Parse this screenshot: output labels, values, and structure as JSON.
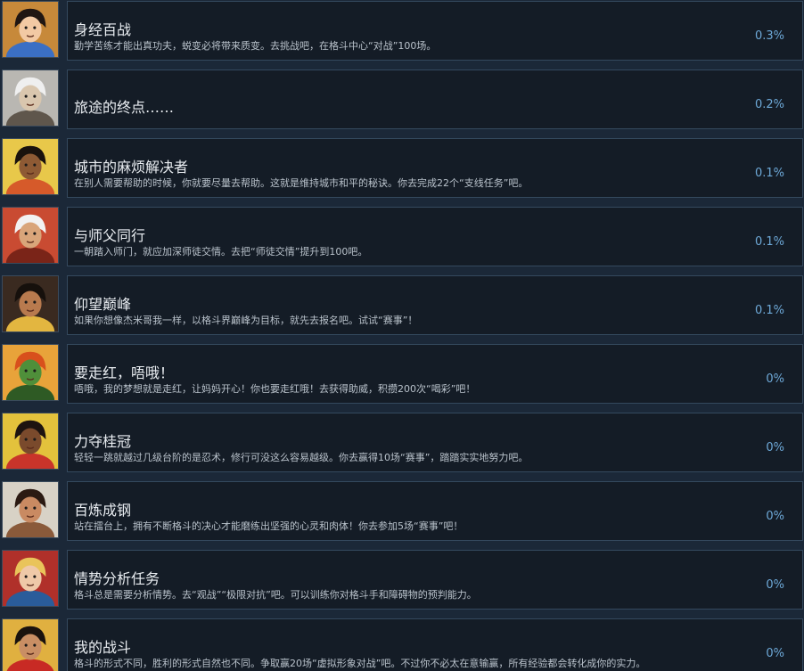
{
  "achievements": [
    {
      "title": "身经百战",
      "desc": "勤学苦练才能出真功夫，蜕变必将带来质变。去挑战吧，在格斗中心“对战”100场。",
      "percent": "0.3%",
      "icon": "portrait-chunli-icon",
      "bg": "#c7893a",
      "skin": "#f2c9a4",
      "hair": "#201612",
      "accent": "#3b6fc4"
    },
    {
      "title": "旅途的终点……",
      "desc": "",
      "percent": "0.2%",
      "icon": "portrait-oro-icon",
      "bg": "#b9b7b2",
      "skin": "#d9c6ae",
      "hair": "#efefef",
      "accent": "#5f564c"
    },
    {
      "title": "城市的麻烦解决者",
      "desc": "在别人需要帮助的时候，你就要尽量去帮助。这就是维持城市和平的秘诀。你去完成22个“支线任务”吧。",
      "percent": "0.1%",
      "icon": "portrait-dhalsim-icon",
      "bg": "#e8c84a",
      "skin": "#8e5a34",
      "hair": "#1a120d",
      "accent": "#d65a2a"
    },
    {
      "title": "与师父同行",
      "desc": "一朝踏入师门，就应加深师徒交情。去把“师徒交情”提升到100吧。",
      "percent": "0.1%",
      "icon": "portrait-zangief-icon",
      "bg": "#c94b32",
      "skin": "#d9a57a",
      "hair": "#f2f2f2",
      "accent": "#7a2418"
    },
    {
      "title": "仰望巅峰",
      "desc": "如果你想像杰米哥我一样，以格斗界巅峰为目标，就先去报名吧。试试“赛事”！",
      "percent": "0.1%",
      "icon": "portrait-jamie-icon",
      "bg": "#3a2a20",
      "skin": "#b87a4e",
      "hair": "#16100c",
      "accent": "#e3b640"
    },
    {
      "title": "要走红，唔哦！",
      "desc": "唔哦，我的梦想就是走红，让妈妈开心！你也要走红哦！去获得助威，积攒200次“喝彩”吧！",
      "percent": "0%",
      "icon": "portrait-blanka-icon",
      "bg": "#e8a33a",
      "skin": "#4f8f3a",
      "hair": "#d8501c",
      "accent": "#2e5a24"
    },
    {
      "title": "力夺桂冠",
      "desc": "轻轻一跳就越过几级台阶的是忍术，修行可没这么容易越级。你去赢得10场“赛事”，踏踏实实地努力吧。",
      "percent": "0%",
      "icon": "portrait-kimberly-icon",
      "bg": "#e3c23c",
      "skin": "#7a4a2c",
      "hair": "#1d1410",
      "accent": "#c9342a"
    },
    {
      "title": "百炼成钢",
      "desc": "站在擂台上，拥有不断格斗的决心才能磨练出坚强的心灵和肉体！你去参加5场“赛事”吧！",
      "percent": "0%",
      "icon": "portrait-marisa-icon",
      "bg": "#d8d2c6",
      "skin": "#c98a62",
      "hair": "#2b1a12",
      "accent": "#8a5a3a"
    },
    {
      "title": "情势分析任务",
      "desc": "格斗总是需要分析情势。去“观战”“极限对抗”吧。可以训练你对格斗手和障碍物的预判能力。",
      "percent": "0%",
      "icon": "portrait-cammy-icon",
      "bg": "#b0302a",
      "skin": "#efc9a8",
      "hair": "#e9c45a",
      "accent": "#2a5c9a"
    },
    {
      "title": "我的战斗",
      "desc": "格斗的形式不同，胜利的形式自然也不同。争取赢20场“虚拟形象对战”吧。不过你不必太在意输赢，所有经验都会转化成你的实力。",
      "percent": "0%",
      "icon": "portrait-ryu-icon",
      "bg": "#e0b040",
      "skin": "#c98e64",
      "hair": "#1a120e",
      "accent": "#c82a24"
    }
  ]
}
